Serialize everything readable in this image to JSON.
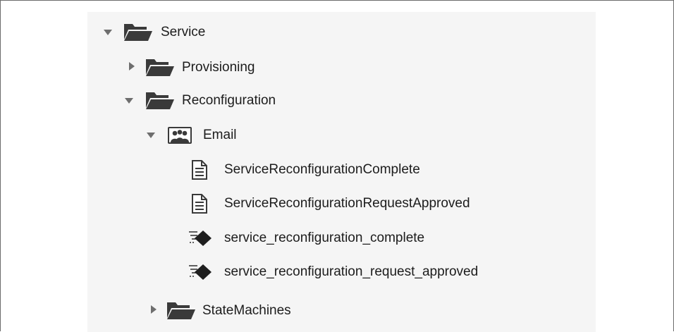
{
  "tree": {
    "service": {
      "label": "Service",
      "expanded": true,
      "icon": "folder-open-icon"
    },
    "provisioning": {
      "label": "Provisioning",
      "expanded": false,
      "icon": "folder-open-icon"
    },
    "reconfiguration": {
      "label": "Reconfiguration",
      "expanded": true,
      "icon": "folder-open-icon"
    },
    "email": {
      "label": "Email",
      "expanded": true,
      "icon": "group-icon"
    },
    "items": [
      {
        "label": "ServiceReconfigurationComplete",
        "icon": "document-icon"
      },
      {
        "label": "ServiceReconfigurationRequestApproved",
        "icon": "document-icon"
      },
      {
        "label": "service_reconfiguration_complete",
        "icon": "diamond-method-icon"
      },
      {
        "label": "service_reconfiguration_request_approved",
        "icon": "diamond-method-icon"
      }
    ],
    "statemachines": {
      "label": "StateMachines",
      "expanded": false,
      "icon": "folder-open-icon"
    }
  },
  "colors": {
    "panel_background": "#f5f5f5",
    "text": "#1c1c1c",
    "icon": "#3a3a3a"
  }
}
